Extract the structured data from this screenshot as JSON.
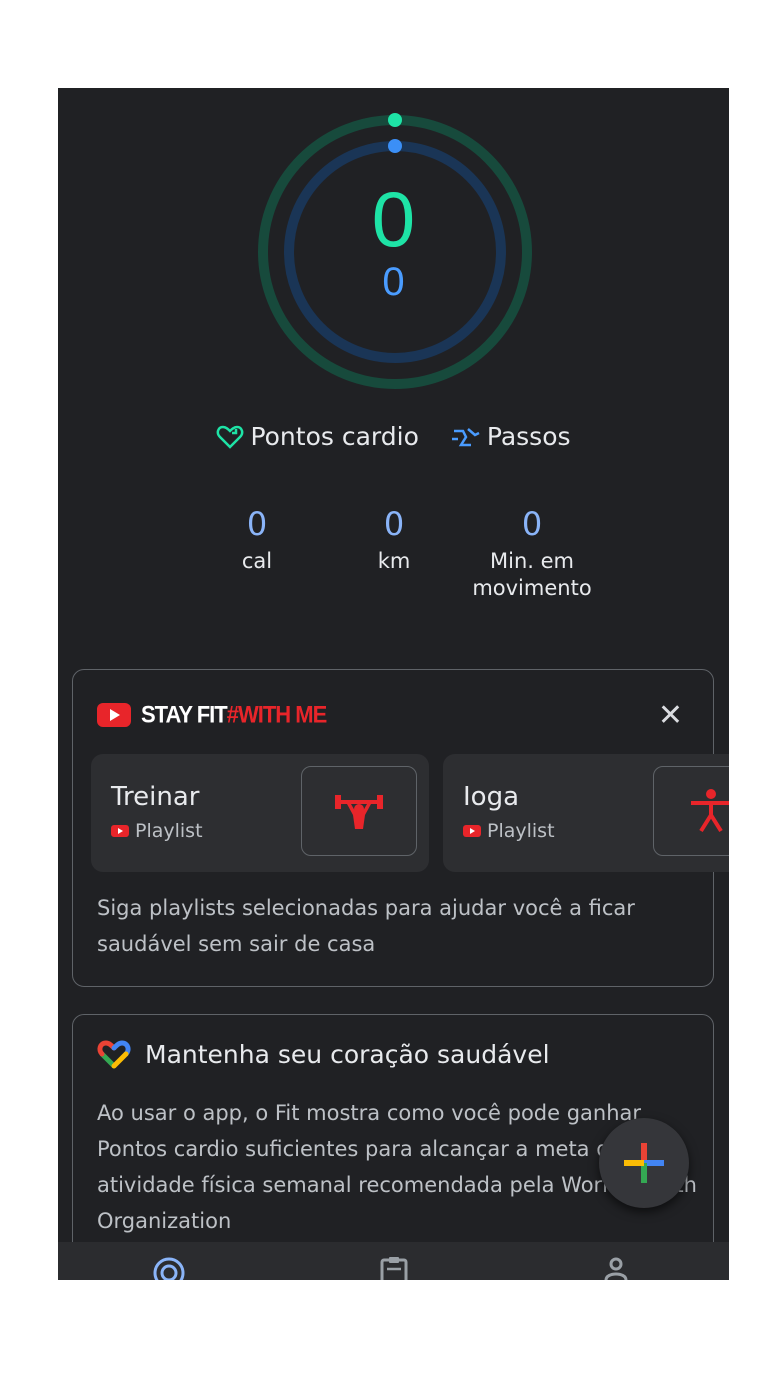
{
  "summary": {
    "cardio_points": "0",
    "steps": "0",
    "cardio_progress": 0,
    "steps_progress": 0
  },
  "legend": {
    "cardio_label": "Pontos cardio",
    "steps_label": "Passos"
  },
  "stats": [
    {
      "value": "0",
      "label": "cal"
    },
    {
      "value": "0",
      "label": "km"
    },
    {
      "value": "0",
      "label": "Min. em movimento"
    }
  ],
  "stayfit_card": {
    "logo_text_1": "STAY FIT",
    "logo_text_2": "#WITH ME",
    "close_label": "✕",
    "tiles": [
      {
        "name": "Treinar",
        "type": "Playlist",
        "icon": "weightlifting-icon"
      },
      {
        "name": "Ioga",
        "type": "Playlist",
        "icon": "yoga-icon"
      }
    ],
    "description": "Siga playlists selecionadas para ajudar você a ficar saudável sem sair de casa"
  },
  "heart_card": {
    "title": "Mantenha seu coração saudável",
    "body": "Ao usar o app, o Fit mostra como você pode ganhar Pontos cardio suficientes para alcançar a meta de atividade física semanal recomendada pela World Health Organization"
  },
  "colors": {
    "cardio": "#1ee3a6",
    "steps": "#4a9cff",
    "youtube_red": "#e8252a"
  },
  "nav": [
    "home-icon",
    "journal-icon",
    "profile-icon"
  ]
}
